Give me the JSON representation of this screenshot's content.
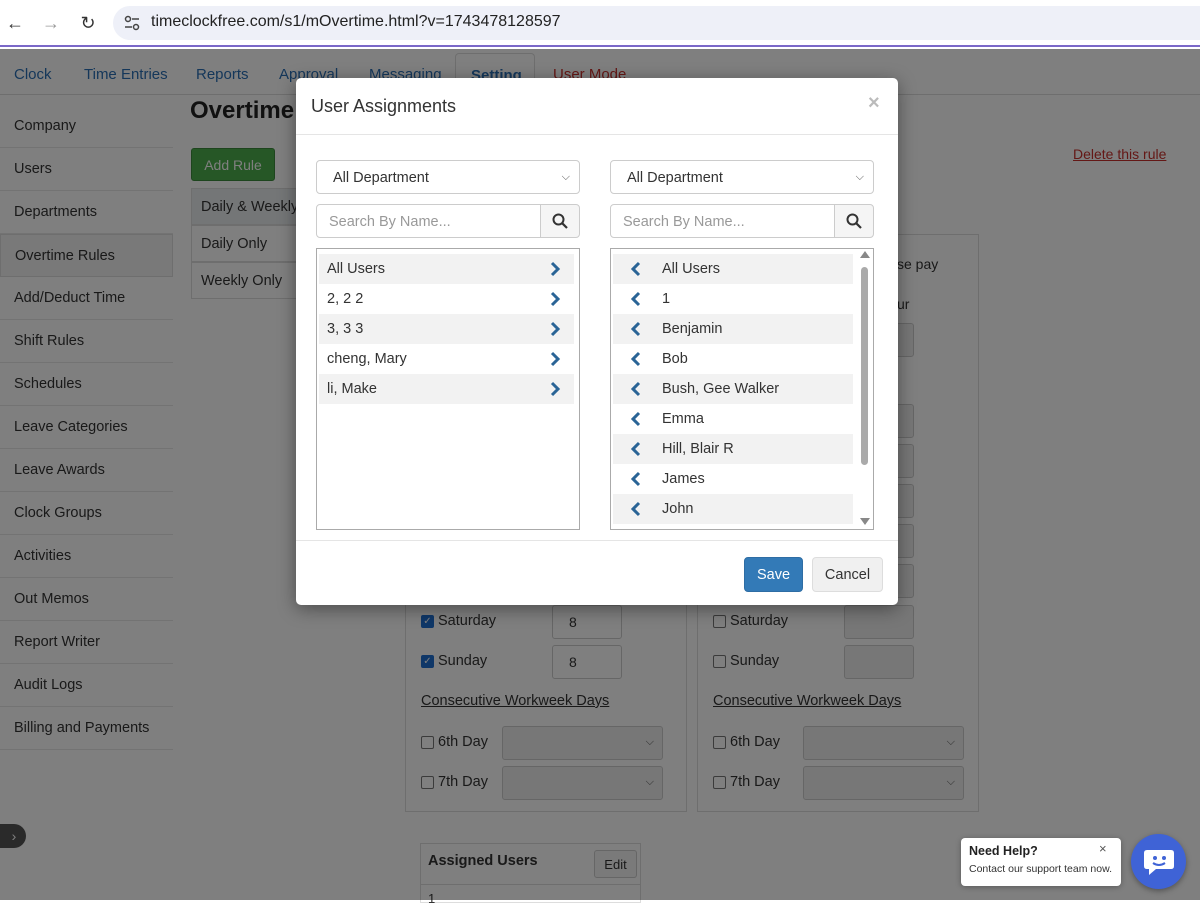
{
  "browser": {
    "url": "timeclockfree.com/s1/mOvertime.html?v=1743478128597"
  },
  "topnav": {
    "items": [
      "Clock",
      "Time Entries",
      "Reports",
      "Approval",
      "Messaging",
      "Setting",
      "User Mode"
    ]
  },
  "sidebar": {
    "items": [
      "Company",
      "Users",
      "Departments",
      "Overtime Rules",
      "Add/Deduct Time",
      "Shift Rules",
      "Schedules",
      "Leave Categories",
      "Leave Awards",
      "Clock Groups",
      "Activities",
      "Out Memos",
      "Report Writer",
      "Audit Logs",
      "Billing and Payments"
    ],
    "active": "Overtime Rules"
  },
  "page": {
    "title": "Overtime",
    "add_rule": "Add Rule",
    "delete_rule": "Delete this rule",
    "rule_types": [
      "Daily & Weekly",
      "Daily Only",
      "Weekly Only"
    ],
    "partial_base_pay": "se pay",
    "partial_hour": "ur",
    "left_col": {
      "saturday": {
        "label": "Saturday",
        "value": "8",
        "checked": true
      },
      "sunday": {
        "label": "Sunday",
        "value": "8",
        "checked": true
      },
      "consecutive": "Consecutive Workweek Days",
      "day6": "6th Day",
      "day7": "7th Day"
    },
    "right_col": {
      "saturday": {
        "label": "Saturday",
        "checked": false
      },
      "sunday": {
        "label": "Sunday",
        "checked": false
      },
      "consecutive": "Consecutive Workweek Days",
      "day6": "6th Day",
      "day7": "7th Day"
    },
    "assigned_users": {
      "title": "Assigned Users",
      "edit": "Edit",
      "first_row": "1"
    }
  },
  "modal": {
    "title": "User Assignments",
    "close": "×",
    "left": {
      "department": "All Department",
      "search_placeholder": "Search By Name...",
      "users": [
        "All Users",
        "2, 2 2",
        "3, 3 3",
        "cheng, Mary",
        "li, Make"
      ]
    },
    "right": {
      "department": "All Department",
      "search_placeholder": "Search By Name...",
      "users": [
        "All Users",
        "1",
        "Benjamin",
        "Bob",
        "Bush, Gee Walker",
        "Emma",
        "Hill, Blair R",
        "James",
        "John"
      ]
    },
    "save": "Save",
    "cancel": "Cancel"
  },
  "help": {
    "title": "Need Help?",
    "subtitle": "Contact our support team now.",
    "close": "×"
  },
  "colors": {
    "accent_blue": "#337ab7",
    "arrow_blue": "#2a6496",
    "add_rule_green": "#4cae4c",
    "delete_red": "#c9302c",
    "chat_blue": "#3f63d6"
  }
}
